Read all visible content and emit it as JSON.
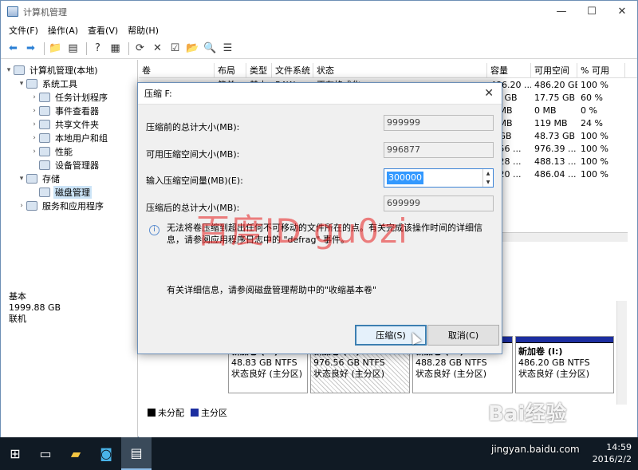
{
  "window": {
    "title": "计算机管理",
    "controls": {
      "minimize": "—",
      "maximize": "☐",
      "close": "✕"
    }
  },
  "menu": [
    "文件(F)",
    "操作(A)",
    "查看(V)",
    "帮助(H)"
  ],
  "tree": [
    {
      "label": "计算机管理(本地)",
      "level": 0,
      "arrow": "▾"
    },
    {
      "label": "系统工具",
      "level": 1,
      "arrow": "▾"
    },
    {
      "label": "任务计划程序",
      "level": 2,
      "arrow": "›"
    },
    {
      "label": "事件查看器",
      "level": 2,
      "arrow": "›"
    },
    {
      "label": "共享文件夹",
      "level": 2,
      "arrow": "›"
    },
    {
      "label": "本地用户和组",
      "level": 2,
      "arrow": "›"
    },
    {
      "label": "性能",
      "level": 2,
      "arrow": "›"
    },
    {
      "label": "设备管理器",
      "level": 2,
      "arrow": ""
    },
    {
      "label": "存储",
      "level": 1,
      "arrow": "▾"
    },
    {
      "label": "磁盘管理",
      "level": 2,
      "arrow": "",
      "selected": true
    },
    {
      "label": "服务和应用程序",
      "level": 1,
      "arrow": "›"
    }
  ],
  "volume_table": {
    "headers": [
      "卷",
      "布局",
      "类型",
      "文件系统",
      "状态",
      "容量",
      "可用空间",
      "% 可用"
    ],
    "rows": [
      [
        "",
        "简单",
        "基本",
        "RAW",
        "正在格式化",
        "486.20 ...",
        "486.20 GB",
        "100 %"
      ],
      [
        "",
        "",
        "",
        "",
        "",
        "51 GB",
        "17.75 GB",
        "60 %"
      ],
      [
        "",
        "",
        "",
        "",
        "",
        "7 MB",
        "0 MB",
        "0 %"
      ],
      [
        "",
        "",
        "",
        "",
        "",
        "0 MB",
        "119 MB",
        "24 %"
      ],
      [
        "",
        "",
        "",
        "",
        "",
        "3 GB",
        "48.73 GB",
        "100 %"
      ],
      [
        "",
        "",
        "",
        "",
        "",
        "5.56 ...",
        "976.39 ...",
        "100 %"
      ],
      [
        "",
        "",
        "",
        "",
        "",
        "3.28 ...",
        "488.13 ...",
        "100 %"
      ],
      [
        "",
        "",
        "",
        "",
        "",
        "5.20 ...",
        "486.04 ...",
        "100 %"
      ]
    ]
  },
  "disk": {
    "name": "基本",
    "size": "1999.88 GB",
    "status": "联机"
  },
  "partitions": [
    {
      "title": "新加卷 (E:)",
      "size": "48.83 GB NTFS",
      "status": "状态良好 (主分区)"
    },
    {
      "title": "新加卷 (F:)",
      "size": "976.56 GB NTFS",
      "status": "状态良好 (主分区)"
    },
    {
      "title": "新加卷 (H:)",
      "size": "488.28 GB NTFS",
      "status": "状态良好 (主分区)"
    },
    {
      "title": "新加卷 (I:)",
      "size": "486.20 GB NTFS",
      "status": "状态良好 (主分区)"
    }
  ],
  "legend": [
    {
      "label": "未分配",
      "color": "#000000"
    },
    {
      "label": "主分区",
      "color": "#1c2ea0"
    }
  ],
  "dialog": {
    "title": "压缩 F:",
    "close": "✕",
    "fields": [
      {
        "label": "压缩前的总计大小(MB):",
        "value": "999999"
      },
      {
        "label": "可用压缩空间大小(MB):",
        "value": "996877"
      },
      {
        "label": "输入压缩空间量(MB)(E):",
        "value": "300000"
      },
      {
        "label": "压缩后的总计大小(MB):",
        "value": "699999"
      }
    ],
    "info": "无法将卷压缩到超出任何不可移动的文件所在的点。有关完成该操作时间的详细信息，请参阅应用程序日志中的 \"defrag\" 事件。",
    "more": "有关详细信息，请参阅磁盘管理帮助中的\"收缩基本卷\"",
    "ok": "压缩(S)",
    "cancel": "取消(C)"
  },
  "watermark": "百度ID gu0zi",
  "taskbar": {
    "time": "14:59",
    "date": "2016/2/2"
  },
  "baidu_logo": "Bai经验",
  "baidu_url": "jingyan.baidu.com",
  "colors": {
    "primary_partition": "#1c2ea0",
    "selection": "#3399ff",
    "taskbar": "#101a24"
  }
}
